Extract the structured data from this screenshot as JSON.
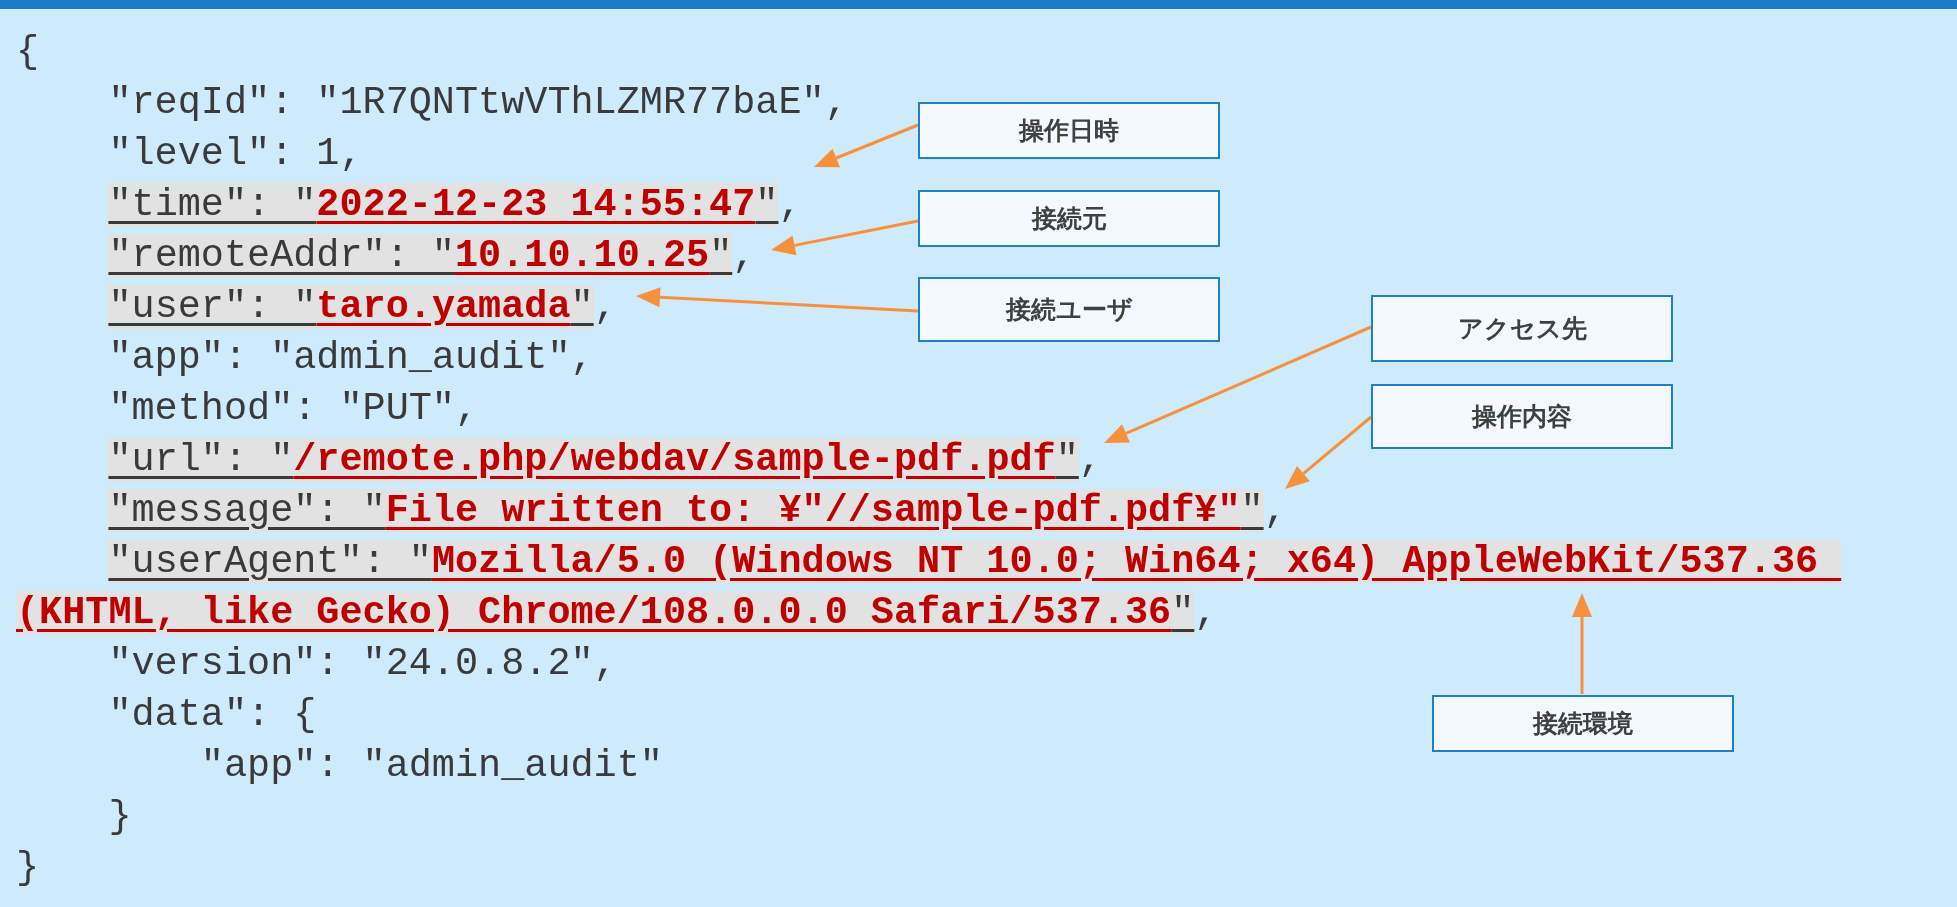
{
  "code_lines": [
    {
      "segments": [
        {
          "kind": "plain",
          "text": "{"
        }
      ]
    },
    {
      "segments": [
        {
          "kind": "plain",
          "text": "    \"reqId\": \"1R7QNTtwVThLZMR77baE\","
        }
      ]
    },
    {
      "segments": [
        {
          "kind": "plain",
          "text": "    \"level\": 1,"
        }
      ]
    },
    {
      "segments": [
        {
          "kind": "key",
          "text": "    \"time\": \""
        },
        {
          "kind": "value",
          "text": "2022-12-23 14:55:47"
        },
        {
          "kind": "key",
          "text": "\""
        },
        {
          "kind": "plain",
          "text": ","
        }
      ]
    },
    {
      "segments": [
        {
          "kind": "key",
          "text": "    \"remoteAddr\": \""
        },
        {
          "kind": "value",
          "text": "10.10.10.25"
        },
        {
          "kind": "key",
          "text": "\""
        },
        {
          "kind": "plain",
          "text": ","
        }
      ]
    },
    {
      "segments": [
        {
          "kind": "key",
          "text": "    \"user\": \""
        },
        {
          "kind": "value",
          "text": "taro.yamada"
        },
        {
          "kind": "key",
          "text": "\""
        },
        {
          "kind": "plain",
          "text": ","
        }
      ]
    },
    {
      "segments": [
        {
          "kind": "plain",
          "text": "    \"app\": \"admin_audit\","
        }
      ]
    },
    {
      "segments": [
        {
          "kind": "plain",
          "text": "    \"method\": \"PUT\","
        }
      ]
    },
    {
      "segments": [
        {
          "kind": "key",
          "text": "    \"url\": \""
        },
        {
          "kind": "value",
          "text": "/remote.php/webdav/sample-pdf.pdf"
        },
        {
          "kind": "key",
          "text": "\""
        },
        {
          "kind": "plain",
          "text": ","
        }
      ]
    },
    {
      "segments": [
        {
          "kind": "key",
          "text": "    \"message\": \""
        },
        {
          "kind": "value",
          "text": "File written to: ¥\"//sample-pdf.pdf¥\""
        },
        {
          "kind": "key",
          "text": "\""
        },
        {
          "kind": "plain",
          "text": ","
        }
      ]
    },
    {
      "segments": [
        {
          "kind": "key",
          "text": "    \"userAgent\": \""
        },
        {
          "kind": "value",
          "text": "Mozilla/5.0 (Windows NT 10.0; Win64; x64) AppleWebKit/537.36 "
        }
      ]
    },
    {
      "segments": [
        {
          "kind": "value",
          "text": "(KHTML, like Gecko) Chrome/108.0.0.0 Safari/537.36"
        },
        {
          "kind": "key",
          "text": "\""
        },
        {
          "kind": "plain",
          "text": ","
        }
      ]
    },
    {
      "segments": [
        {
          "kind": "plain",
          "text": "    \"version\": \"24.0.8.2\","
        }
      ]
    },
    {
      "segments": [
        {
          "kind": "plain",
          "text": "    \"data\": {"
        }
      ]
    },
    {
      "segments": [
        {
          "kind": "plain",
          "text": "        \"app\": \"admin_audit\""
        }
      ]
    },
    {
      "segments": [
        {
          "kind": "plain",
          "text": "    }"
        }
      ]
    },
    {
      "segments": [
        {
          "kind": "plain",
          "text": "}"
        }
      ]
    }
  ],
  "callouts": [
    {
      "label": "操作日時"
    },
    {
      "label": "接続元"
    },
    {
      "label": "接続ユーザ"
    },
    {
      "label": "アクセス先"
    },
    {
      "label": "操作内容"
    },
    {
      "label": "接続環境"
    }
  ]
}
